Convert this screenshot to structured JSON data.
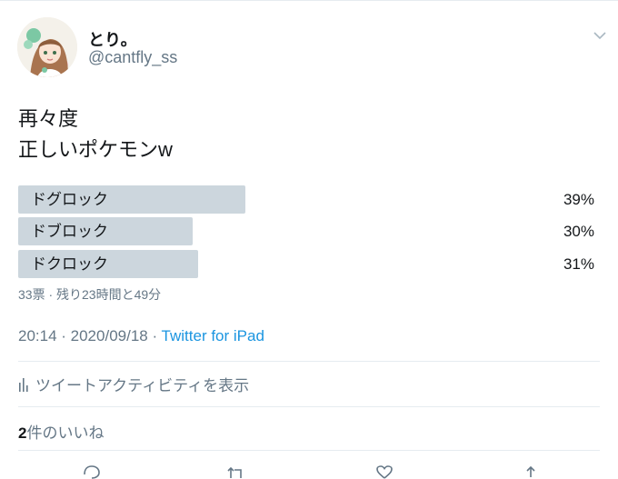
{
  "user": {
    "display_name": "とり。",
    "handle": "@cantfly_ss"
  },
  "tweet": {
    "lines": [
      "再々度",
      "正しいポケモンw"
    ]
  },
  "poll": {
    "options": [
      {
        "label": "ドグロック",
        "percent": "39%",
        "share": 0.39
      },
      {
        "label": "ドブロック",
        "percent": "30%",
        "share": 0.3
      },
      {
        "label": "ドクロック",
        "percent": "31%",
        "share": 0.31
      }
    ],
    "meta": "33票 · 残り23時間と49分"
  },
  "timestamp": {
    "time_date": "20:14 · 2020/09/18 · ",
    "source": "Twitter for iPad"
  },
  "activity_label": "ツイートアクティビティを表示",
  "likes": {
    "count": "2",
    "label": "件のいいね"
  },
  "colors": {
    "poll_bar": "#ccd6dd",
    "link": "#1b95e0",
    "secondary_text": "#657786"
  },
  "icons": [
    "chevron-down-icon",
    "bar-chart-icon",
    "reply-icon",
    "retweet-icon",
    "like-icon",
    "share-icon"
  ]
}
